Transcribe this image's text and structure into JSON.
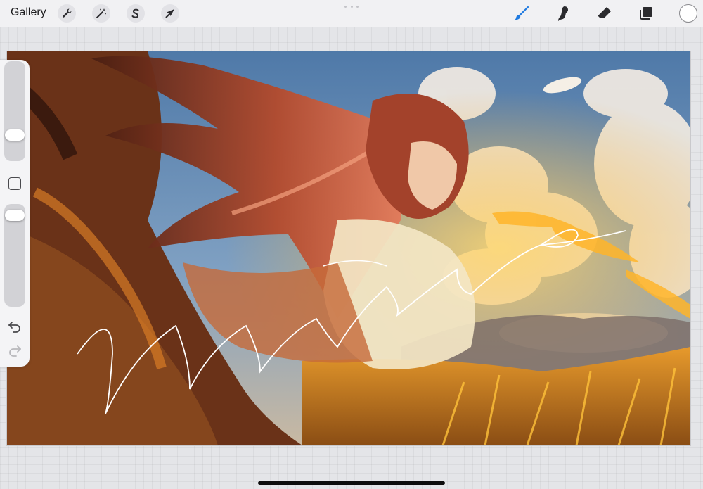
{
  "toolbar": {
    "gallery_label": "Gallery",
    "left_tools": [
      "wrench-icon",
      "magic-wand-icon",
      "selection-s-icon",
      "arrow-cursor-icon"
    ],
    "right_tools": [
      "brush-icon",
      "smudge-icon",
      "eraser-icon",
      "layers-icon"
    ],
    "active_tool": "brush-icon",
    "accent_color": "#1f7ae0",
    "current_color": "#ffffff"
  },
  "sidebar": {
    "brush_size_slider": {
      "level": 0.22
    },
    "opacity_slider": {
      "level": 0.95
    },
    "controls": [
      "modify-button",
      "undo-icon",
      "redo-icon"
    ]
  },
  "canvas": {
    "artwork": "anime-girl-wind-wheat-field",
    "stroke_color": "#ffffff"
  }
}
